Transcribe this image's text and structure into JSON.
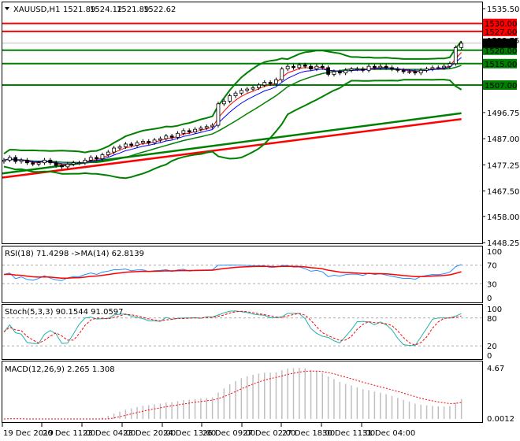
{
  "header": {
    "symbol": "XAUUSD,H1",
    "open": "1521.89",
    "high": "1524.12",
    "low": "1521.89",
    "close": "1522.62"
  },
  "price_axis": [
    "1535.50",
    "1523.75",
    "1496.75",
    "1487.00",
    "1477.25",
    "1467.50",
    "1458.00",
    "1448.25"
  ],
  "levels": [
    {
      "label": "1530.00",
      "value": 1530.0,
      "color": "#ff0000"
    },
    {
      "label": "1527.00",
      "value": 1527.0,
      "color": "#ff0000"
    },
    {
      "label": "1520.00",
      "value": 1520.0,
      "color": "#008000"
    },
    {
      "label": "1515.00",
      "value": 1515.0,
      "color": "#008000"
    },
    {
      "label": "1507.00",
      "value": 1507.0,
      "color": "#008000"
    }
  ],
  "current_price": {
    "label": "1522.62",
    "value": 1522.62
  },
  "rsi": {
    "title": "RSI(18) 71.4298  ->MA(14) 62.8139",
    "axis": [
      "100",
      "70",
      "30",
      "0"
    ]
  },
  "stoch": {
    "title": "Stoch(5,3,3) 90.1544 91.0597",
    "axis": [
      "100",
      "80",
      "20",
      "0"
    ]
  },
  "macd": {
    "title": "MACD(12,26,9) 2.265 1.308",
    "axis": [
      "4.67",
      "0.0012"
    ]
  },
  "time_axis": [
    "19 Dec 2019",
    "20 Dec 11:00",
    "23 Dec 04:00",
    "23 Dec 20:00",
    "24 Dec 13:00",
    "26 Dec 09:00",
    "27 Dec 02:00",
    "27 Dec 18:00",
    "30 Dec 11:00",
    "31 Dec 04:00"
  ],
  "colors": {
    "bull": "#000000",
    "ma_slow": "#ff0000",
    "ma_mid": "#008000",
    "bands": "#008000",
    "rsi": "#1e90ff",
    "signal": "#ff0000",
    "stoch": "#20b2aa",
    "hist": "#c0c0c0"
  },
  "chart_data": {
    "type": "candlestick",
    "closes": [
      1479,
      1480,
      1478.5,
      1479,
      1478,
      1477.5,
      1478,
      1479,
      1478,
      1477,
      1476.5,
      1477.5,
      1478,
      1478,
      1479,
      1480,
      1479.5,
      1481,
      1482,
      1483.5,
      1484,
      1485,
      1484.5,
      1485.5,
      1486,
      1485.5,
      1486.5,
      1487,
      1488,
      1487.5,
      1489,
      1490,
      1489.5,
      1490.5,
      1491,
      1491.5,
      1492,
      1500,
      1501,
      1503,
      1504,
      1505,
      1505.5,
      1506,
      1507,
      1508,
      1507.5,
      1509,
      1513,
      1514,
      1513.5,
      1514.5,
      1514,
      1513,
      1514,
      1513.5,
      1511,
      1512,
      1511.5,
      1512.5,
      1513,
      1513,
      1512.5,
      1514,
      1513.5,
      1514,
      1513.5,
      1513,
      1512.5,
      1512,
      1512,
      1511.5,
      1512.5,
      1513,
      1513.5,
      1513.5,
      1514,
      1515,
      1521,
      1522.6
    ],
    "ma_slow": [
      1472.5,
      1494.3
    ],
    "ma_mid": [
      1474,
      1496.5
    ],
    "ylim": [
      1448.25,
      1535.5
    ]
  }
}
